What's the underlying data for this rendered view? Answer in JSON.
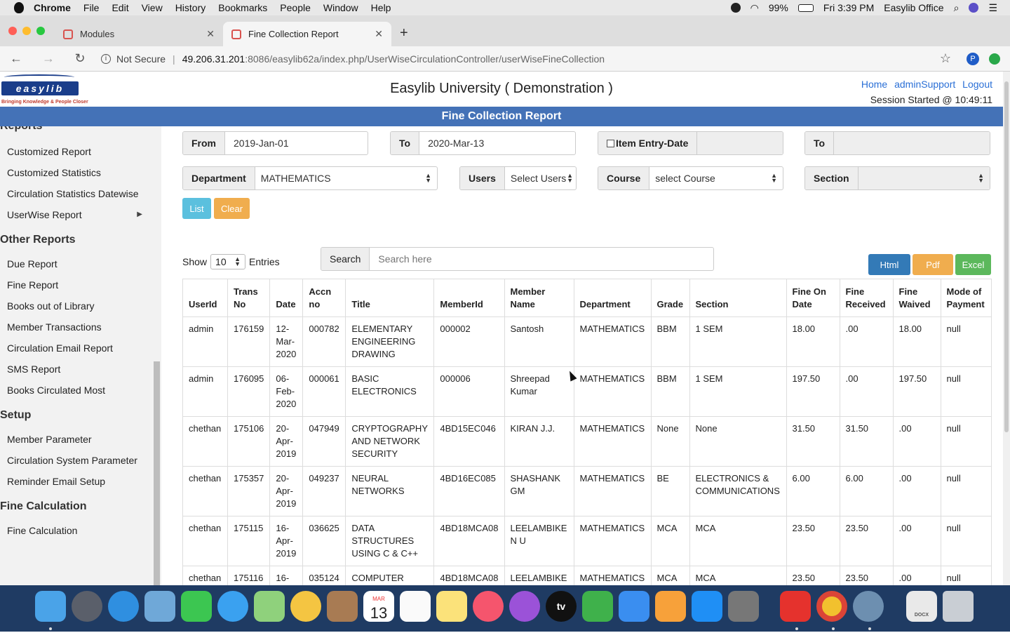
{
  "menubar": {
    "app": "Chrome",
    "items": [
      "File",
      "Edit",
      "View",
      "History",
      "Bookmarks",
      "People",
      "Window",
      "Help"
    ],
    "battery": "99%",
    "clock": "Fri 3:39 PM",
    "user": "Easylib Office"
  },
  "tabs": [
    {
      "title": "Modules"
    },
    {
      "title": "Fine Collection Report"
    }
  ],
  "address": {
    "security": "Not Secure",
    "host": "49.206.31.201",
    "path": ":8086/easylib62a/index.php/UserWiseCirculationController/userWiseFineCollection",
    "profile": "P"
  },
  "header": {
    "logo_text": "easylib",
    "logo_tagline": "Bringing Knowledge & People Closer",
    "university": "Easylib University ( Demonstration )",
    "links": [
      "Home",
      "adminSupport",
      "Logout"
    ],
    "session": "Session Started @ 10:49:11",
    "page_title": "Fine Collection Report"
  },
  "sidebar": {
    "partial_section": "Reports",
    "rows": [
      {
        "kind": "item",
        "label": "Customized Report"
      },
      {
        "kind": "item",
        "label": "Customized Statistics"
      },
      {
        "kind": "item",
        "label": "Circulation Statistics Datewise"
      },
      {
        "kind": "item",
        "label": "UserWise Report",
        "submenu": true
      },
      {
        "kind": "section",
        "label": "Other Reports"
      },
      {
        "kind": "item",
        "label": "Due Report"
      },
      {
        "kind": "item",
        "label": "Fine Report"
      },
      {
        "kind": "item",
        "label": "Books out of Library"
      },
      {
        "kind": "item",
        "label": "Member Transactions"
      },
      {
        "kind": "item",
        "label": "Circulation Email Report"
      },
      {
        "kind": "item",
        "label": "SMS Report"
      },
      {
        "kind": "item",
        "label": "Books Circulated Most"
      },
      {
        "kind": "section",
        "label": "Setup"
      },
      {
        "kind": "item",
        "label": "Member Parameter"
      },
      {
        "kind": "item",
        "label": "Circulation System Parameter"
      },
      {
        "kind": "item",
        "label": "Reminder Email Setup"
      },
      {
        "kind": "section",
        "label": "Fine Calculation"
      },
      {
        "kind": "item",
        "label": "Fine Calculation"
      }
    ]
  },
  "filters": {
    "from_label": "From",
    "from_value": "2019-Jan-01",
    "to_label": "To",
    "to_value": "2020-Mar-13",
    "entry_date_label": "Item Entry-Date",
    "to2_label": "To",
    "department_label": "Department",
    "department_value": "MATHEMATICS",
    "users_label": "Users",
    "users_value": "Select Users",
    "course_label": "Course",
    "course_value": "select Course",
    "section_label": "Section",
    "section_value": "",
    "list_btn": "List",
    "clear_btn": "Clear"
  },
  "table_controls": {
    "show_label": "Show",
    "show_value": "10",
    "entries_label": "Entries",
    "search_label": "Search",
    "search_placeholder": "Search here",
    "html_btn": "Html",
    "pdf_btn": "Pdf",
    "excel_btn": "Excel"
  },
  "table": {
    "headers": [
      "UserId",
      "Trans No",
      "Date",
      "Accn no",
      "Title",
      "MemberId",
      "Member Name",
      "Department",
      "Grade",
      "Section",
      "Fine On Date",
      "Fine Received",
      "Fine Waived",
      "Mode of Payment"
    ],
    "rows": [
      [
        "admin",
        "176159",
        "12-Mar-2020",
        "000782",
        "ELEMENTARY ENGINEERING DRAWING",
        "000002",
        "Santosh",
        "MATHEMATICS",
        "BBM",
        "1 SEM",
        "18.00",
        ".00",
        "18.00",
        "null"
      ],
      [
        "admin",
        "176095",
        "06-Feb-2020",
        "000061",
        "BASIC ELECTRONICS",
        "000006",
        "Shreepad Kumar",
        "MATHEMATICS",
        "BBM",
        "1 SEM",
        "197.50",
        ".00",
        "197.50",
        "null"
      ],
      [
        "chethan",
        "175106",
        "20-Apr-2019",
        "047949",
        "CRYPTOGRAPHY AND NETWORK SECURITY",
        "4BD15EC046",
        "KIRAN J.J.",
        "MATHEMATICS",
        "None",
        "None",
        "31.50",
        "31.50",
        ".00",
        "null"
      ],
      [
        "chethan",
        "175357",
        "20-Apr-2019",
        "049237",
        "NEURAL NETWORKS",
        "4BD16EC085",
        "SHASHANK GM",
        "MATHEMATICS",
        "BE",
        "ELECTRONICS & COMMUNICATIONS",
        "6.00",
        "6.00",
        ".00",
        "null"
      ],
      [
        "chethan",
        "175115",
        "16-Apr-2019",
        "036625",
        "DATA STRUCTURES USING C & C++",
        "4BD18MCA08",
        "LEELAMBIKE N U",
        "MATHEMATICS",
        "MCA",
        "MCA",
        "23.50",
        "23.50",
        ".00",
        "null"
      ],
      [
        "chethan",
        "175116",
        "16-",
        "035124",
        "COMPUTER",
        "4BD18MCA08",
        "LEELAMBIKE",
        "MATHEMATICS",
        "MCA",
        "MCA",
        "23.50",
        "23.50",
        ".00",
        "null"
      ]
    ]
  },
  "colors": {
    "title_bar": "#4472b7",
    "list_btn": "#5bc0de",
    "clear_btn": "#f0ad4e",
    "html_btn": "#337ab7",
    "pdf_btn": "#f0ad4e",
    "excel_btn": "#5cb85c",
    "link": "#2a6fd6"
  },
  "dock": {
    "calendar_month": "MAR",
    "calendar_day": "13",
    "tv_label": "tv",
    "docs_label": "DOCX"
  }
}
